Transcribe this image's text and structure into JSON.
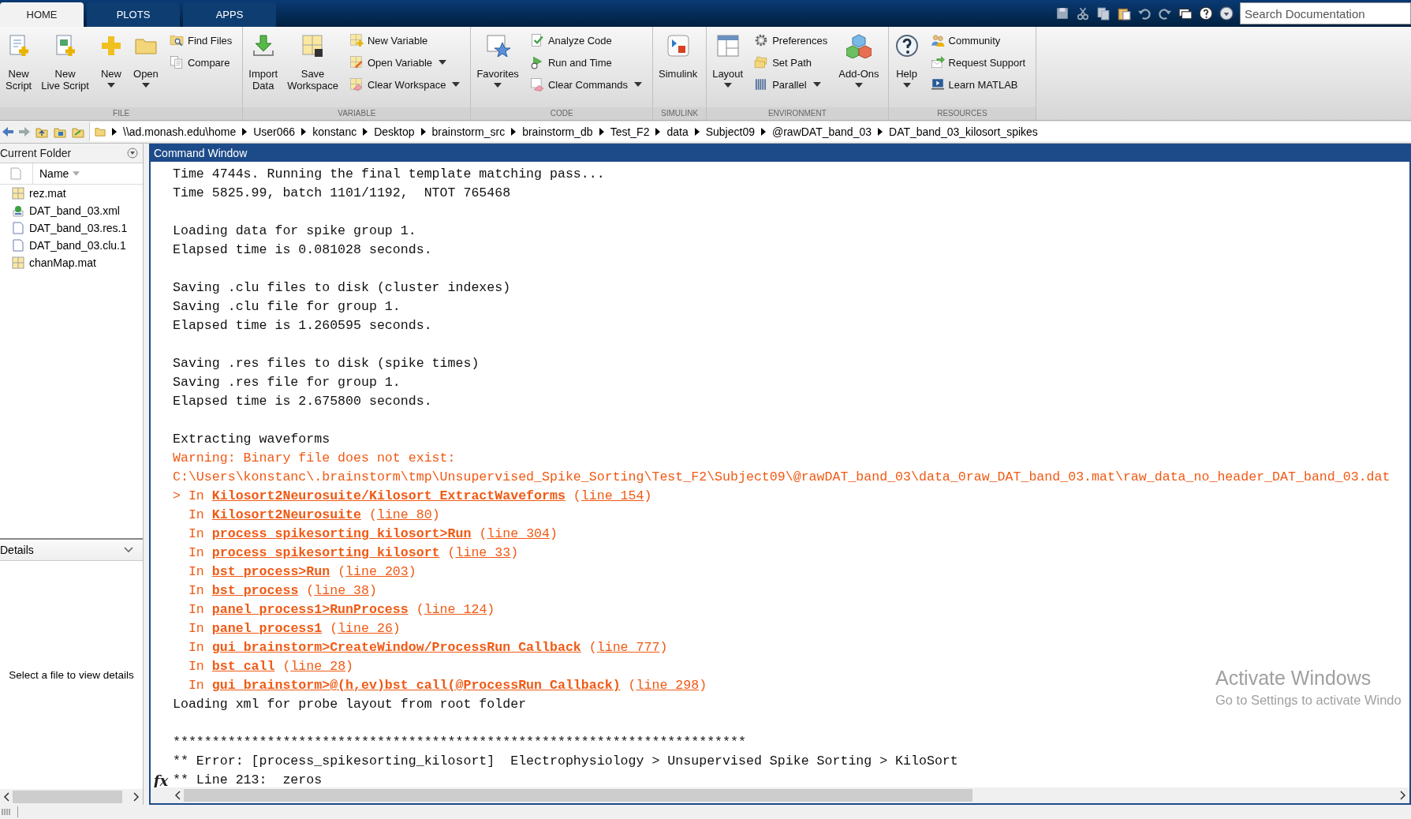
{
  "tabs": [
    {
      "label": "HOME",
      "selected": true
    },
    {
      "label": "PLOTS",
      "selected": false
    },
    {
      "label": "APPS",
      "selected": false
    }
  ],
  "search": {
    "placeholder": "Search Documentation"
  },
  "toolbar": {
    "groups": [
      {
        "label": "FILE",
        "items": [
          {
            "kind": "large",
            "label": "New\nScript",
            "caret": false
          },
          {
            "kind": "large",
            "label": "New\nLive Script",
            "caret": false
          },
          {
            "kind": "large",
            "label": "New",
            "caret": true
          },
          {
            "kind": "large",
            "label": "Open",
            "caret": true
          },
          {
            "kind": "stack",
            "items": [
              {
                "label": "Find Files",
                "caret": false
              },
              {
                "label": "Compare",
                "caret": false
              }
            ]
          }
        ]
      },
      {
        "label": "VARIABLE",
        "items": [
          {
            "kind": "large",
            "label": "Import\nData",
            "caret": false
          },
          {
            "kind": "large",
            "label": "Save\nWorkspace",
            "caret": false
          },
          {
            "kind": "stack",
            "items": [
              {
                "label": "New Variable",
                "caret": false
              },
              {
                "label": "Open Variable",
                "caret": true
              },
              {
                "label": "Clear Workspace",
                "caret": true
              }
            ]
          }
        ]
      },
      {
        "label": "CODE",
        "items": [
          {
            "kind": "large",
            "label": "Favorites",
            "caret": true
          },
          {
            "kind": "stack",
            "items": [
              {
                "label": "Analyze Code",
                "caret": false
              },
              {
                "label": "Run and Time",
                "caret": false
              },
              {
                "label": "Clear Commands",
                "caret": true
              }
            ]
          }
        ]
      },
      {
        "label": "SIMULINK",
        "items": [
          {
            "kind": "large",
            "label": "Simulink",
            "caret": false
          }
        ]
      },
      {
        "label": "ENVIRONMENT",
        "items": [
          {
            "kind": "large",
            "label": "Layout",
            "caret": true
          },
          {
            "kind": "stack",
            "items": [
              {
                "label": "Preferences",
                "caret": false
              },
              {
                "label": "Set Path",
                "caret": false
              },
              {
                "label": "Parallel",
                "caret": true
              }
            ]
          },
          {
            "kind": "large",
            "label": "Add-Ons",
            "caret": true
          }
        ]
      },
      {
        "label": "RESOURCES",
        "items": [
          {
            "kind": "large",
            "label": "Help",
            "caret": true
          },
          {
            "kind": "stack",
            "items": [
              {
                "label": "Community",
                "caret": false
              },
              {
                "label": "Request Support",
                "caret": false
              },
              {
                "label": "Learn MATLAB",
                "caret": false
              }
            ]
          }
        ]
      }
    ]
  },
  "address_bar": {
    "segments": [
      "\\\\ad.monash.edu\\home",
      "User066",
      "konstanc",
      "Desktop",
      "brainstorm_src",
      "brainstorm_db",
      "Test_F2",
      "data",
      "Subject09",
      "@rawDAT_band_03",
      "DAT_band_03_kilosort_spikes"
    ]
  },
  "current_folder": {
    "title": "Current Folder",
    "column": "Name",
    "files": [
      {
        "name": "rez.mat",
        "kind": "mat"
      },
      {
        "name": "DAT_band_03.xml",
        "kind": "xml"
      },
      {
        "name": "DAT_band_03.res.1",
        "kind": "file"
      },
      {
        "name": "DAT_band_03.clu.1",
        "kind": "file"
      },
      {
        "name": "chanMap.mat",
        "kind": "mat"
      }
    ]
  },
  "details": {
    "title": "Details",
    "message": "Select a file to view details"
  },
  "command_window": {
    "title": "Command Window",
    "prompt_icon": "fx",
    "lines": [
      {
        "kind": "text",
        "text": "Time 4744s. Running the final template matching pass..."
      },
      {
        "kind": "text",
        "text": "Time 5825.99, batch 1101/1192,  NTOT 765468"
      },
      {
        "kind": "blank"
      },
      {
        "kind": "text",
        "text": "Loading data for spike group 1."
      },
      {
        "kind": "text",
        "text": "Elapsed time is 0.081028 seconds."
      },
      {
        "kind": "blank"
      },
      {
        "kind": "text",
        "text": "Saving .clu files to disk (cluster indexes)"
      },
      {
        "kind": "text",
        "text": "Saving .clu file for group 1."
      },
      {
        "kind": "text",
        "text": "Elapsed time is 1.260595 seconds."
      },
      {
        "kind": "blank"
      },
      {
        "kind": "text",
        "text": "Saving .res files to disk (spike times)"
      },
      {
        "kind": "text",
        "text": "Saving .res file for group 1."
      },
      {
        "kind": "text",
        "text": "Elapsed time is 2.675800 seconds."
      },
      {
        "kind": "blank"
      },
      {
        "kind": "text",
        "text": "Extracting waveforms"
      },
      {
        "kind": "warning",
        "text": "Warning: Binary file does not exist:"
      },
      {
        "kind": "warning",
        "text": "C:\\Users\\konstanc\\.brainstorm\\tmp\\Unsupervised_Spike_Sorting\\Test_F2\\Subject09\\@rawDAT_band_03\\data_0raw_DAT_band_03.mat\\raw_data_no_header_DAT_band_03.dat"
      },
      {
        "kind": "trace",
        "prefix": "> In ",
        "function": "Kilosort2Neurosuite/Kilosort_ExtractWaveforms",
        "open": " (",
        "location": "line 154",
        "close": ")"
      },
      {
        "kind": "trace",
        "prefix": "  In ",
        "function": "Kilosort2Neurosuite",
        "open": " (",
        "location": "line 80",
        "close": ")"
      },
      {
        "kind": "trace",
        "prefix": "  In ",
        "function": "process_spikesorting_kilosort>Run",
        "open": " (",
        "location": "line 304",
        "close": ")"
      },
      {
        "kind": "trace",
        "prefix": "  In ",
        "function": "process_spikesorting_kilosort",
        "open": " (",
        "location": "line 33",
        "close": ")"
      },
      {
        "kind": "trace",
        "prefix": "  In ",
        "function": "bst_process>Run",
        "open": " (",
        "location": "line 203",
        "close": ")"
      },
      {
        "kind": "trace",
        "prefix": "  In ",
        "function": "bst_process",
        "open": " (",
        "location": "line 38",
        "close": ")"
      },
      {
        "kind": "trace",
        "prefix": "  In ",
        "function": "panel_process1>RunProcess",
        "open": " (",
        "location": "line 124",
        "close": ")"
      },
      {
        "kind": "trace",
        "prefix": "  In ",
        "function": "panel_process1",
        "open": " (",
        "location": "line 26",
        "close": ")"
      },
      {
        "kind": "trace",
        "prefix": "  In ",
        "function": "gui_brainstorm>CreateWindow/ProcessRun_Callback",
        "open": " (",
        "location": "line 777",
        "close": ")"
      },
      {
        "kind": "trace",
        "prefix": "  In ",
        "function": "bst_call",
        "open": " (",
        "location": "line 28",
        "close": ")"
      },
      {
        "kind": "trace",
        "prefix": "  In ",
        "function": "gui_brainstorm>@(h,ev)bst_call(@ProcessRun_Callback)",
        "open": " (",
        "location": "line 298",
        "close": ")"
      },
      {
        "kind": "text",
        "text": "Loading xml for probe layout from root folder"
      },
      {
        "kind": "blank"
      },
      {
        "kind": "text",
        "text": "*************************************************************************"
      },
      {
        "kind": "text",
        "text": "** Error: [process_spikesorting_kilosort]  Electrophysiology > Unsupervised Spike Sorting > KiloSort"
      },
      {
        "kind": "text",
        "text": "** Line 213:  zeros"
      }
    ]
  },
  "os_notice": {
    "title": "Activate Windows",
    "subtitle": "Go to Settings to activate Windo"
  }
}
